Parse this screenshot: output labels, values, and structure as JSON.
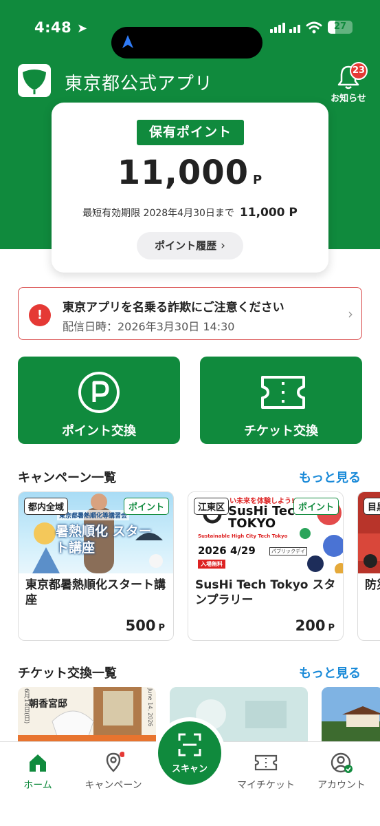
{
  "status_bar": {
    "time": "4:48",
    "battery": "27"
  },
  "header": {
    "app_title": "東京都公式アプリ",
    "notif_label": "お知らせ",
    "notif_count": "23"
  },
  "points": {
    "label": "保有ポイント",
    "value": "11,000",
    "unit": "P",
    "expiry_label": "最短有効期限 2028年4月30日まで",
    "expiry_amount": "11,000 P",
    "history_label": "ポイント履歴"
  },
  "alert": {
    "title": "東京アプリを名乗る詐欺にご注意ください",
    "date": "配信日時：2026年3月30日 14:30"
  },
  "actions": {
    "point_exchange": "ポイント交換",
    "ticket_exchange": "チケット交換"
  },
  "campaigns": {
    "title": "キャンペーン一覧",
    "more": "もっと見る",
    "items": [
      {
        "region": "都内全域",
        "tag": "ポイント",
        "image_text": "東京都暑熱順化等講習会",
        "image_title": "暑熱順化 スタート講座",
        "name": "東京都暑熱順化スタート講座",
        "points": "500",
        "unit": "P"
      },
      {
        "region": "江東区",
        "tag": "ポイント",
        "image_text": "い未来を体験しよう!!",
        "image_title": "SusHi Tech TOKYO",
        "image_sub": "Sustainable High City Tech Tokyo",
        "image_date": "2026 4/29",
        "image_extra": "パブリックデイ",
        "image_free": "入場無料",
        "name": "SusHi Tech Tokyo スタンプラリー",
        "points": "200",
        "unit": "P"
      },
      {
        "region": "目黒",
        "name": "防災"
      }
    ]
  },
  "tickets": {
    "title": "チケット交換一覧",
    "more": "もっと見る",
    "img1_text": "朝香宮邸",
    "img1_small": "6月14日(日)",
    "img1_side": "June 14, 2026"
  },
  "nav": {
    "home": "ホーム",
    "campaign": "キャンペーン",
    "scan": "スキャン",
    "my_ticket": "マイチケット",
    "account": "アカウント"
  },
  "colors": {
    "brand_green": "#108a3d",
    "alert_red": "#e53935",
    "link_blue": "#1a8ad8"
  }
}
